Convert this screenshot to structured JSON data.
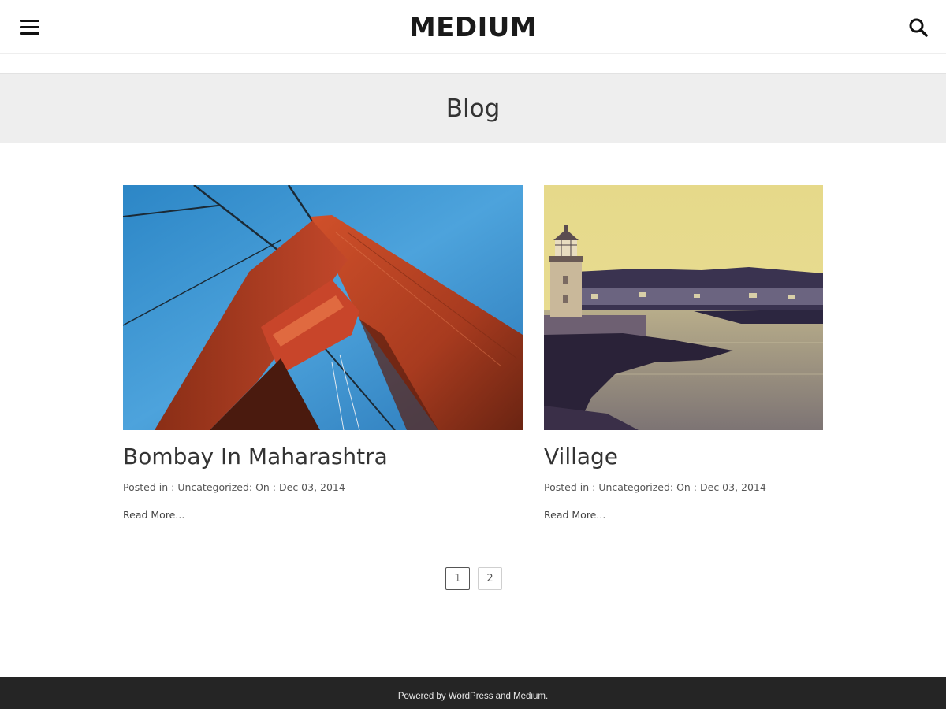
{
  "header": {
    "site_title": "MEDIUM",
    "menu_icon": "hamburger-menu-icon",
    "search_icon": "search-icon"
  },
  "page": {
    "title": "Blog"
  },
  "posts": [
    {
      "title": "Bombay In Maharashtra",
      "meta_posted_prefix": "Posted in : ",
      "category": "Uncategorized",
      "meta_on_prefix": ": On : ",
      "date": "Dec 03, 2014",
      "read_more": "Read More...",
      "image": "bridge-tower-photo"
    },
    {
      "title": "Village",
      "meta_posted_prefix": "Posted in : ",
      "category": "Uncategorized",
      "meta_on_prefix": ": On : ",
      "date": "Dec 03, 2014",
      "read_more": "Read More...",
      "image": "lighthouse-harbor-photo"
    }
  ],
  "pagination": {
    "pages": [
      "1",
      "2"
    ],
    "current": "1"
  },
  "footer": {
    "prefix": "Powered by ",
    "wordpress_link": "WordPress",
    "middle": " and ",
    "theme_link": "Medium",
    "suffix": "."
  },
  "colors": {
    "footer_bg": "#252525",
    "title_band_bg": "#eeeeee"
  }
}
